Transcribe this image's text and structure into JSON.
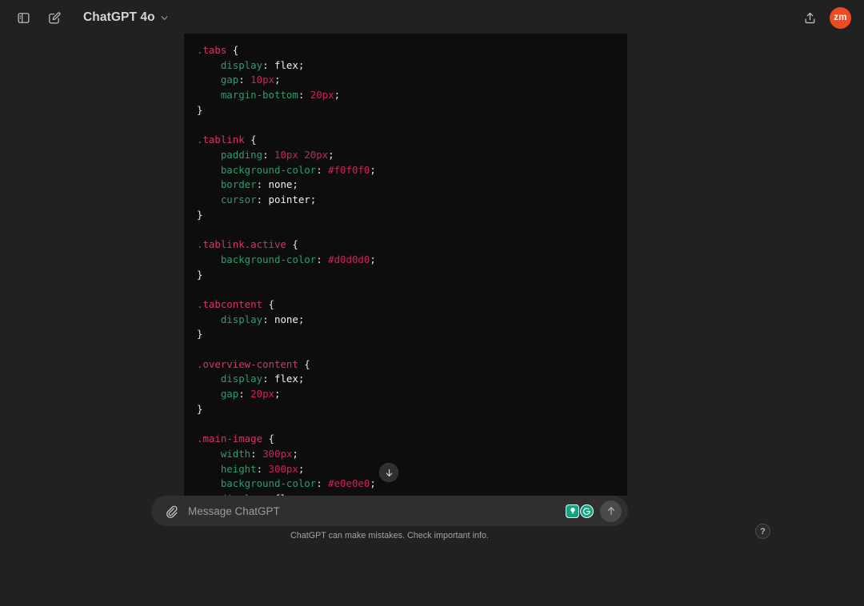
{
  "topbar": {
    "sidebar_toggle_icon": "sidebar-panel-icon",
    "new_chat_icon": "compose-pencil-icon",
    "model_name": "ChatGPT 4o",
    "chevron_icon": "chevron-down-icon",
    "share_icon": "share-upload-icon",
    "avatar_initials": "zm",
    "avatar_color": "#ef4a23"
  },
  "code_block": {
    "language": "css",
    "background": "#0d0d0d",
    "colors": {
      "selector": "#d1356e",
      "property": "#2e9c6a",
      "value": "#c9245f",
      "keyword": "#f2f2f2",
      "punctuation": "#e6e6e6"
    },
    "lines": [
      {
        "segments": [
          {
            "t": ".tabs",
            "c": "sel"
          },
          {
            "t": " {",
            "c": "punc"
          }
        ]
      },
      {
        "segments": [
          {
            "t": "    ",
            "c": "punc"
          },
          {
            "t": "display",
            "c": "prop"
          },
          {
            "t": ": ",
            "c": "punc"
          },
          {
            "t": "flex",
            "c": "kw"
          },
          {
            "t": ";",
            "c": "punc"
          }
        ]
      },
      {
        "segments": [
          {
            "t": "    ",
            "c": "punc"
          },
          {
            "t": "gap",
            "c": "prop"
          },
          {
            "t": ": ",
            "c": "punc"
          },
          {
            "t": "10px",
            "c": "val"
          },
          {
            "t": ";",
            "c": "punc"
          }
        ]
      },
      {
        "segments": [
          {
            "t": "    ",
            "c": "punc"
          },
          {
            "t": "margin-bottom",
            "c": "prop"
          },
          {
            "t": ": ",
            "c": "punc"
          },
          {
            "t": "20px",
            "c": "val"
          },
          {
            "t": ";",
            "c": "punc"
          }
        ]
      },
      {
        "segments": [
          {
            "t": "}",
            "c": "punc"
          }
        ]
      },
      {
        "segments": [
          {
            "t": "",
            "c": "punc"
          }
        ]
      },
      {
        "segments": [
          {
            "t": ".tablink",
            "c": "sel"
          },
          {
            "t": " {",
            "c": "punc"
          }
        ]
      },
      {
        "segments": [
          {
            "t": "    ",
            "c": "punc"
          },
          {
            "t": "padding",
            "c": "prop"
          },
          {
            "t": ": ",
            "c": "punc"
          },
          {
            "t": "10px 20px",
            "c": "val"
          },
          {
            "t": ";",
            "c": "punc"
          }
        ]
      },
      {
        "segments": [
          {
            "t": "    ",
            "c": "punc"
          },
          {
            "t": "background-color",
            "c": "prop"
          },
          {
            "t": ": ",
            "c": "punc"
          },
          {
            "t": "#f0f0f0",
            "c": "val"
          },
          {
            "t": ";",
            "c": "punc"
          }
        ]
      },
      {
        "segments": [
          {
            "t": "    ",
            "c": "punc"
          },
          {
            "t": "border",
            "c": "prop"
          },
          {
            "t": ": ",
            "c": "punc"
          },
          {
            "t": "none",
            "c": "kw"
          },
          {
            "t": ";",
            "c": "punc"
          }
        ]
      },
      {
        "segments": [
          {
            "t": "    ",
            "c": "punc"
          },
          {
            "t": "cursor",
            "c": "prop"
          },
          {
            "t": ": ",
            "c": "punc"
          },
          {
            "t": "pointer",
            "c": "kw"
          },
          {
            "t": ";",
            "c": "punc"
          }
        ]
      },
      {
        "segments": [
          {
            "t": "}",
            "c": "punc"
          }
        ]
      },
      {
        "segments": [
          {
            "t": "",
            "c": "punc"
          }
        ]
      },
      {
        "segments": [
          {
            "t": ".tablink.active",
            "c": "sel"
          },
          {
            "t": " {",
            "c": "punc"
          }
        ]
      },
      {
        "segments": [
          {
            "t": "    ",
            "c": "punc"
          },
          {
            "t": "background-color",
            "c": "prop"
          },
          {
            "t": ": ",
            "c": "punc"
          },
          {
            "t": "#d0d0d0",
            "c": "val"
          },
          {
            "t": ";",
            "c": "punc"
          }
        ]
      },
      {
        "segments": [
          {
            "t": "}",
            "c": "punc"
          }
        ]
      },
      {
        "segments": [
          {
            "t": "",
            "c": "punc"
          }
        ]
      },
      {
        "segments": [
          {
            "t": ".tabcontent",
            "c": "sel"
          },
          {
            "t": " {",
            "c": "punc"
          }
        ]
      },
      {
        "segments": [
          {
            "t": "    ",
            "c": "punc"
          },
          {
            "t": "display",
            "c": "prop"
          },
          {
            "t": ": ",
            "c": "punc"
          },
          {
            "t": "none",
            "c": "kw"
          },
          {
            "t": ";",
            "c": "punc"
          }
        ]
      },
      {
        "segments": [
          {
            "t": "}",
            "c": "punc"
          }
        ]
      },
      {
        "segments": [
          {
            "t": "",
            "c": "punc"
          }
        ]
      },
      {
        "segments": [
          {
            "t": ".overview-content",
            "c": "sel"
          },
          {
            "t": " {",
            "c": "punc"
          }
        ]
      },
      {
        "segments": [
          {
            "t": "    ",
            "c": "punc"
          },
          {
            "t": "display",
            "c": "prop"
          },
          {
            "t": ": ",
            "c": "punc"
          },
          {
            "t": "flex",
            "c": "kw"
          },
          {
            "t": ";",
            "c": "punc"
          }
        ]
      },
      {
        "segments": [
          {
            "t": "    ",
            "c": "punc"
          },
          {
            "t": "gap",
            "c": "prop"
          },
          {
            "t": ": ",
            "c": "punc"
          },
          {
            "t": "20px",
            "c": "val"
          },
          {
            "t": ";",
            "c": "punc"
          }
        ]
      },
      {
        "segments": [
          {
            "t": "}",
            "c": "punc"
          }
        ]
      },
      {
        "segments": [
          {
            "t": "",
            "c": "punc"
          }
        ]
      },
      {
        "segments": [
          {
            "t": ".main-image",
            "c": "sel"
          },
          {
            "t": " {",
            "c": "punc"
          }
        ]
      },
      {
        "segments": [
          {
            "t": "    ",
            "c": "punc"
          },
          {
            "t": "width",
            "c": "prop"
          },
          {
            "t": ": ",
            "c": "punc"
          },
          {
            "t": "300px",
            "c": "val"
          },
          {
            "t": ";",
            "c": "punc"
          }
        ]
      },
      {
        "segments": [
          {
            "t": "    ",
            "c": "punc"
          },
          {
            "t": "height",
            "c": "prop"
          },
          {
            "t": ": ",
            "c": "punc"
          },
          {
            "t": "300px",
            "c": "val"
          },
          {
            "t": ";",
            "c": "punc"
          }
        ]
      },
      {
        "segments": [
          {
            "t": "    ",
            "c": "punc"
          },
          {
            "t": "background-color",
            "c": "prop"
          },
          {
            "t": ": ",
            "c": "punc"
          },
          {
            "t": "#e0e0e0",
            "c": "val"
          },
          {
            "t": ";",
            "c": "punc"
          }
        ]
      },
      {
        "segments": [
          {
            "t": "    ",
            "c": "punc"
          },
          {
            "t": "display",
            "c": "prop"
          },
          {
            "t": ": ",
            "c": "punc"
          },
          {
            "t": "flex",
            "c": "kw"
          },
          {
            "t": ";",
            "c": "punc"
          }
        ]
      }
    ]
  },
  "scroll_down": {
    "icon": "arrow-down-icon"
  },
  "composer": {
    "attach_icon": "paperclip-icon",
    "placeholder": "Message ChatGPT",
    "value": "",
    "extension_icons": [
      {
        "name": "lightbulb-icon",
        "glyph": "●",
        "color": "#15a37f"
      },
      {
        "name": "grammarly-icon",
        "glyph": "G",
        "color": "#15a37f"
      }
    ],
    "send_icon": "arrow-up-icon"
  },
  "footer": {
    "disclaimer": "ChatGPT can make mistakes. Check important info.",
    "help_label": "?"
  }
}
